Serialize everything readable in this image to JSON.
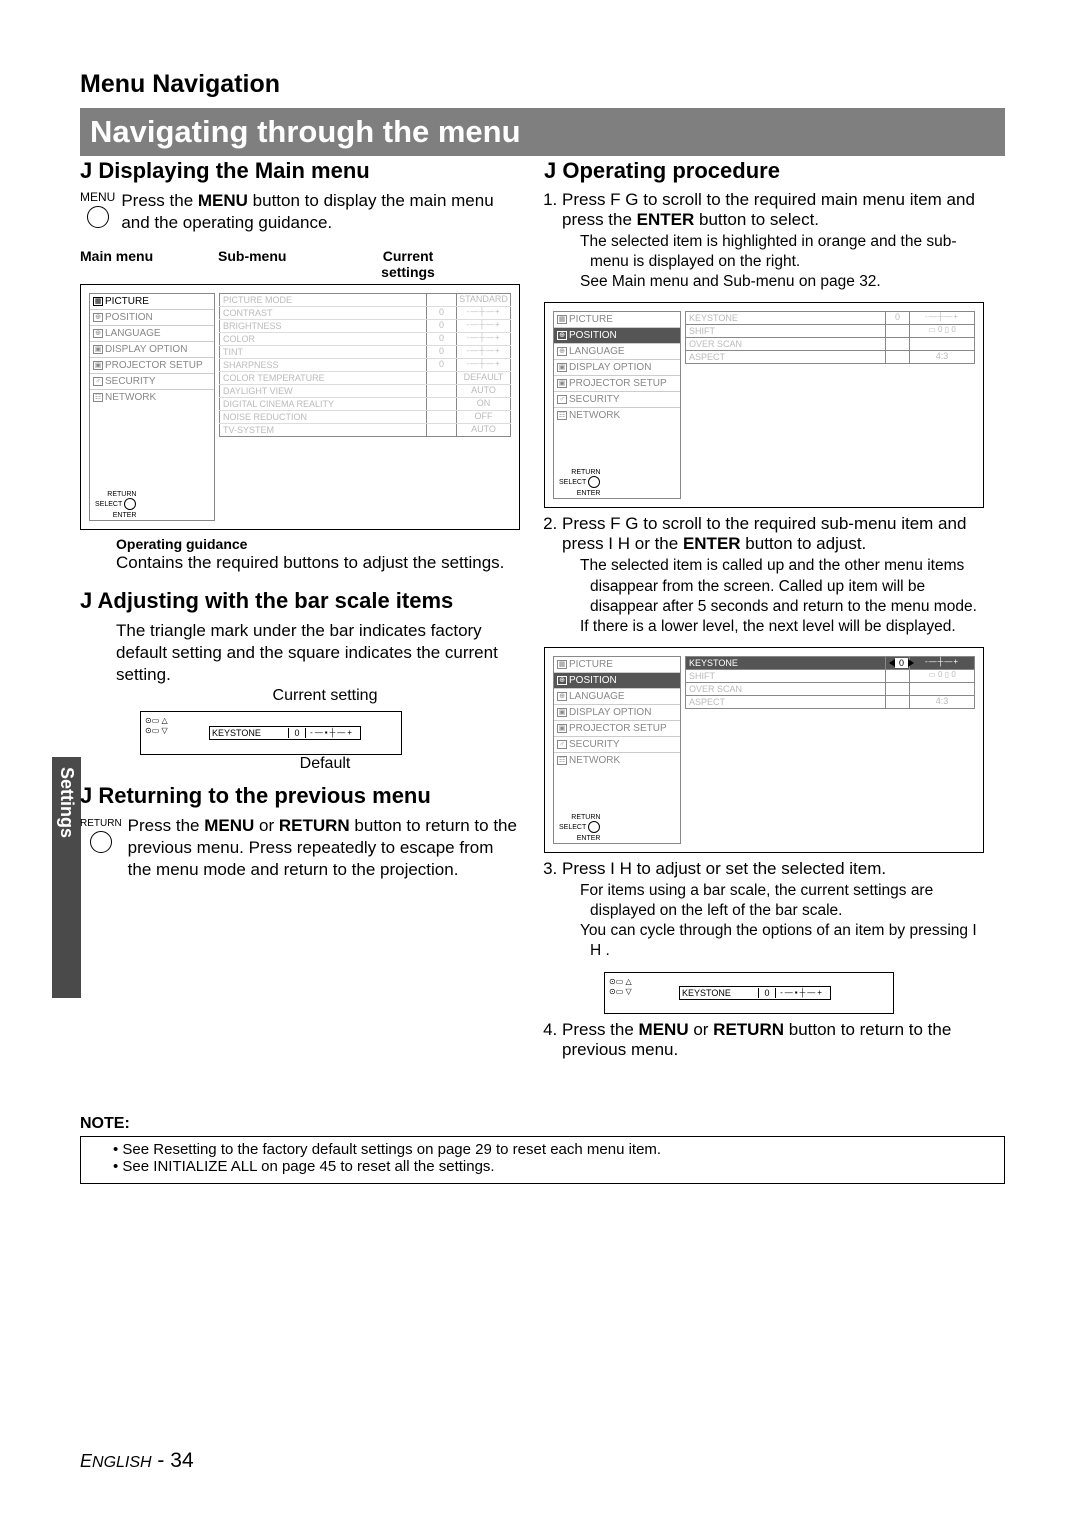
{
  "page_header": "Menu Navigation",
  "title": "Navigating through the menu",
  "side_tab": "Settings",
  "left": {
    "sec1_h": "J  Displaying the Main menu",
    "sec1_menu_label": "MENU",
    "sec1_text": "Press the MENU button to display the main menu and the operating guidance.",
    "labels": {
      "main": "Main menu",
      "sub": "Sub-menu",
      "cur_line1": "Current",
      "cur_line2": "settings"
    },
    "main_menu": [
      "PICTURE",
      "POSITION",
      "LANGUAGE",
      "DISPLAY OPTION",
      "PROJECTOR SETUP",
      "SECURITY",
      "NETWORK"
    ],
    "sub_menu": [
      {
        "name": "PICTURE MODE",
        "val": "",
        "set": "STANDARD"
      },
      {
        "name": "CONTRAST",
        "val": "0",
        "set": "slider"
      },
      {
        "name": "BRIGHTNESS",
        "val": "0",
        "set": "slider"
      },
      {
        "name": "COLOR",
        "val": "0",
        "set": "slider"
      },
      {
        "name": "TINT",
        "val": "0",
        "set": "slider"
      },
      {
        "name": "SHARPNESS",
        "val": "0",
        "set": "slider"
      },
      {
        "name": "COLOR TEMPERATURE",
        "val": "",
        "set": "DEFAULT"
      },
      {
        "name": "DAYLIGHT VIEW",
        "val": "",
        "set": "AUTO"
      },
      {
        "name": "DIGITAL CINEMA REALITY",
        "val": "",
        "set": "ON"
      },
      {
        "name": "NOISE REDUCTION",
        "val": "",
        "set": "OFF"
      },
      {
        "name": "TV-SYSTEM",
        "val": "",
        "set": "AUTO"
      }
    ],
    "remote": {
      "return": "RETURN",
      "select": "SELECT",
      "enter": "ENTER"
    },
    "og_h": "Operating guidance",
    "og_t": "Contains the required buttons to adjust the settings.",
    "sec2_h": "J  Adjusting with the bar scale items",
    "sec2_t": "The triangle mark under the bar indicates factory default setting and the square indicates the current setting.",
    "cur_cap": "Current setting",
    "def_cap": "Default",
    "keystone_label": "KEYSTONE",
    "keystone_val": "0",
    "sec3_h": "J  Returning to the previous menu",
    "sec3_return_label": "RETURN",
    "sec3_t": "Press the MENU or RETURN button to return to the previous menu. Press repeatedly to escape from the menu mode and return to the projection."
  },
  "right": {
    "sec1_h": "J  Operating procedure",
    "step1": "Press F G to scroll to the required main menu item and press the ENTER button to select.",
    "step1_b1": "The selected item is highlighted in orange and the sub-menu is displayed on the right.",
    "step1_b2": "See  Main menu and Sub-menu  on page 32.",
    "d1_sub": [
      {
        "name": "KEYSTONE",
        "val": "0",
        "set": "slider"
      },
      {
        "name": "SHIFT",
        "val": "",
        "set": "shift"
      },
      {
        "name": "OVER SCAN",
        "val": "",
        "set": ""
      },
      {
        "name": "ASPECT",
        "val": "",
        "set": "4:3"
      }
    ],
    "step2": "Press F G to scroll to the required sub-menu item and press I H or the ENTER button to adjust.",
    "step2_b1": "The selected item is called up and the other menu items disappear from the screen. Called up item will be disappear after 5 seconds and return to the menu mode.",
    "step2_b2": "If there is a lower level, the next level will be displayed.",
    "step3": "Press I H to adjust or set the selected item.",
    "step3_b1": "For items using a bar scale, the current settings are displayed on the left of the bar scale.",
    "step3_b2": "You can cycle through the options of an item by pressing I H .",
    "step4": "Press the MENU or RETURN button to return to the previous menu.",
    "shift_vals": {
      "a": "0",
      "b": "0"
    }
  },
  "note": {
    "h": "NOTE:",
    "l1": "See  Resetting to the factory default settings  on page 29 to reset each menu item.",
    "l2": "See  INITIALIZE ALL  on page 45 to reset all the settings."
  },
  "footer": {
    "eng": "English",
    "dash": " - ",
    "num": "34"
  }
}
